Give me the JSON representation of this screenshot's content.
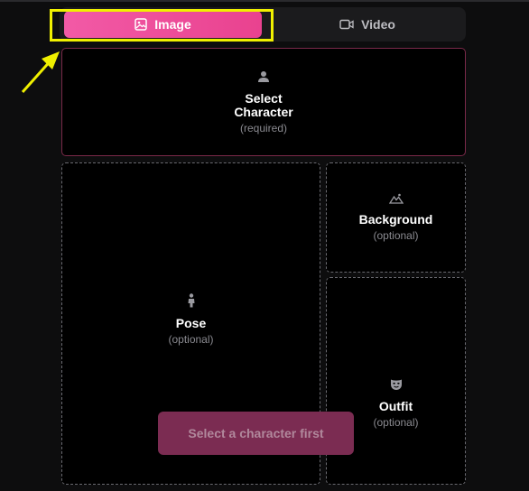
{
  "tabs": {
    "image_label": "Image",
    "video_label": "Video",
    "active": "image"
  },
  "colors": {
    "accent": "#ee4f9c",
    "highlight": "#f0f000",
    "background": "#0d0d0e"
  },
  "slots": {
    "character": {
      "title": "Select Character",
      "hint": "(required)",
      "icon": "person-icon"
    },
    "pose": {
      "title": "Pose",
      "hint": "(optional)",
      "icon": "figure-icon"
    },
    "background": {
      "title": "Background",
      "hint": "(optional)",
      "icon": "landscape-icon"
    },
    "outfit": {
      "title": "Outfit",
      "hint": "(optional)",
      "icon": "mask-icon"
    }
  },
  "cta": {
    "label": "Select a character first",
    "enabled": false
  }
}
